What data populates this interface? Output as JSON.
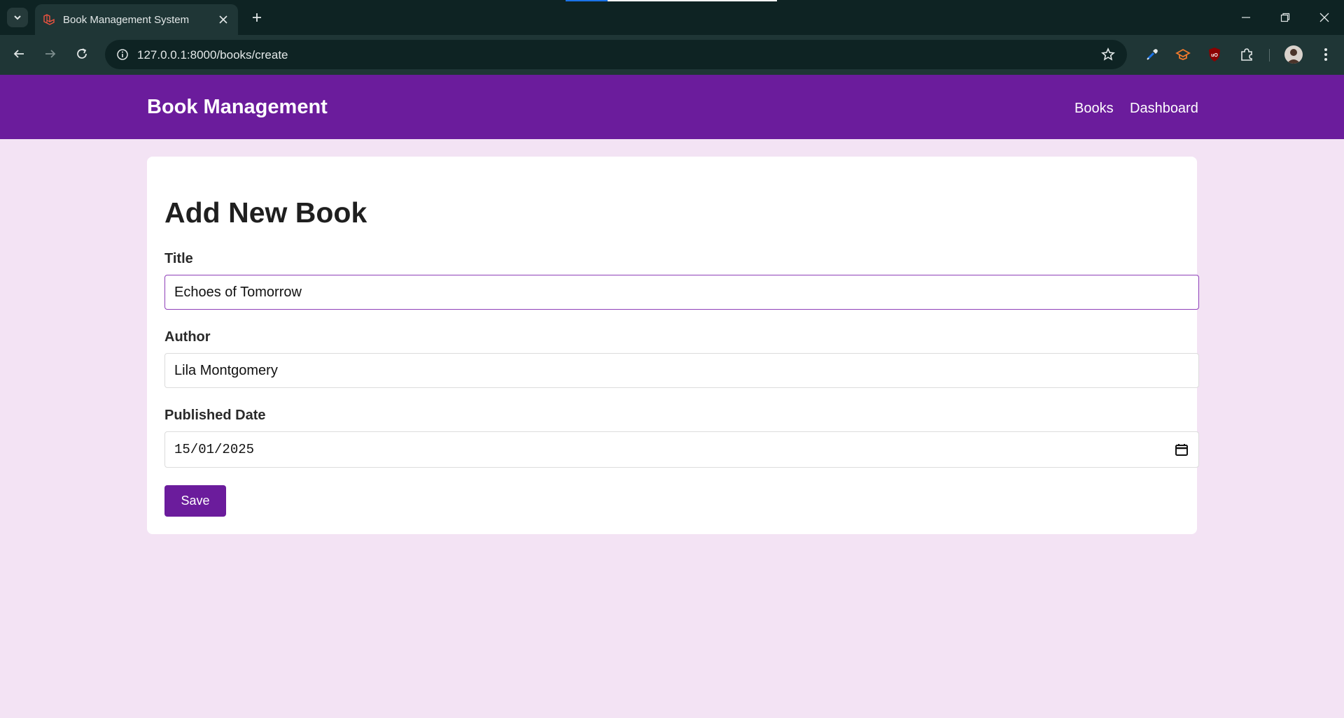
{
  "browser": {
    "tab_title": "Book Management System",
    "url": "127.0.0.1:8000/books/create"
  },
  "header": {
    "brand": "Book Management",
    "nav": [
      "Books",
      "Dashboard"
    ]
  },
  "form": {
    "heading": "Add New Book",
    "title_label": "Title",
    "title_value": "Echoes of Tomorrow",
    "author_label": "Author",
    "author_value": "Lila Montgomery",
    "date_label": "Published Date",
    "date_value": "15/01/2025",
    "save_label": "Save"
  },
  "colors": {
    "header": "#6b1c9c",
    "page_bg": "#f3e3f4",
    "button": "#6b1c9c"
  }
}
